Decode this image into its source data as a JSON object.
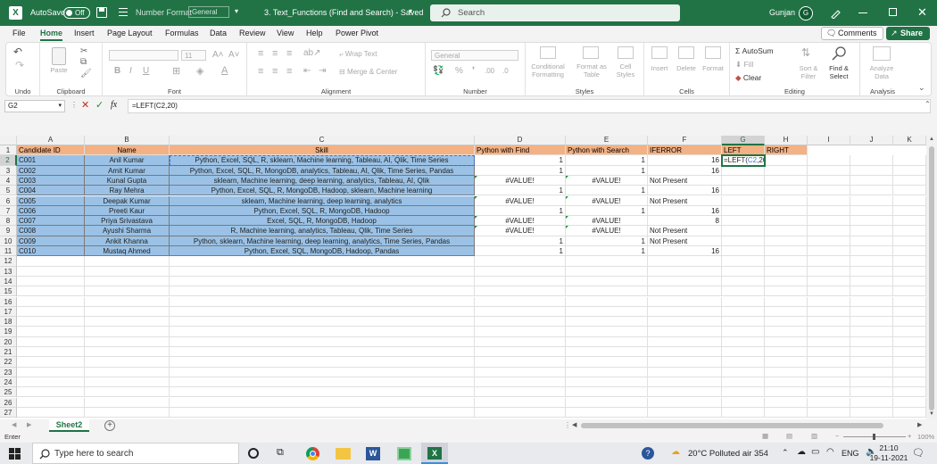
{
  "titlebar": {
    "autosave": "AutoSave",
    "toggle": "Off",
    "number_format": "Number Format",
    "number_format_value": "General",
    "doc_title": "3. Text_Functions (Find and Search)  -  Saved",
    "search_placeholder": "Search",
    "user": "Gunjan",
    "avatar_initial": "G"
  },
  "menu": {
    "tabs": [
      "File",
      "Home",
      "Insert",
      "Page Layout",
      "Formulas",
      "Data",
      "Review",
      "View",
      "Help",
      "Power Pivot"
    ],
    "comments": "Comments",
    "share": "Share"
  },
  "ribbon": {
    "undo": "Undo",
    "clipboard": "Clipboard",
    "paste": "Paste",
    "font": "Font",
    "font_size": "11",
    "alignment": "Alignment",
    "wrap_text": "Wrap Text",
    "merge_center": "Merge & Center",
    "number": "Number",
    "number_format": "General",
    "styles": "Styles",
    "conditional": "Conditional",
    "formatting": "Formatting",
    "format_as": "Format as",
    "table": "Table",
    "cell": "Cell",
    "styles2": "Styles",
    "cells": "Cells",
    "insert": "Insert",
    "delete": "Delete",
    "format": "Format",
    "editing": "Editing",
    "autosum": "AutoSum",
    "fill": "Fill",
    "clear": "Clear",
    "sort": "Sort &",
    "filter": "Filter",
    "find": "Find &",
    "select": "Select",
    "analyze": "Analyze",
    "data": "Data",
    "analysis": "Analysis"
  },
  "formula_bar": {
    "name_box": "G2",
    "fx": "fx",
    "formula": "=LEFT(C2,20)"
  },
  "grid": {
    "columns": [
      "A",
      "B",
      "C",
      "D",
      "E",
      "F",
      "G",
      "H",
      "I",
      "J",
      "K"
    ],
    "rows": [
      "1",
      "2",
      "3",
      "4",
      "5",
      "6",
      "7",
      "8",
      "9",
      "10",
      "11",
      "12",
      "13",
      "14",
      "15",
      "16",
      "17",
      "18",
      "19",
      "20",
      "21",
      "22",
      "23",
      "24",
      "25",
      "26",
      "27"
    ],
    "headers": [
      "Candidate ID",
      "Name",
      "Skill",
      "Python with Find",
      "Python with Search",
      "IFERROR",
      "LEFT",
      "RIGHT"
    ],
    "data": [
      [
        "C001",
        "Anil Kumar",
        "Python, Excel, SQL, R, sklearn, Machine learning, Tableau, AI, Qlik, Time Series",
        "1",
        "1",
        "16"
      ],
      [
        "C002",
        "Amit Kumar",
        "Python, Excel, SQL, R, MongoDB, analytics, Tableau, AI, Qlik, Time Series, Pandas",
        "1",
        "1",
        "16"
      ],
      [
        "C003",
        "Kunal Gupta",
        "sklearn, Machine learning, deep learning, analytics, Tableau, AI, Qlik",
        "#VALUE!",
        "#VALUE!",
        "Not Present"
      ],
      [
        "C004",
        "Ray Mehra",
        "Python, Excel, SQL, R, MongoDB, Hadoop, sklearn, Machine learning",
        "1",
        "1",
        "16"
      ],
      [
        "C005",
        "Deepak Kumar",
        "sklearn, Machine learning, deep learning, analytics",
        "#VALUE!",
        "#VALUE!",
        "Not Present"
      ],
      [
        "C006",
        "Preeti Kaur",
        "Python, Excel, SQL, R, MongoDB, Hadoop",
        "1",
        "1",
        "16"
      ],
      [
        "C007",
        "Priya Srivastava",
        "Excel, SQL, R, MongoDB, Hadoop",
        "#VALUE!",
        "#VALUE!",
        "8"
      ],
      [
        "C008",
        "Ayushi Sharma",
        "R, Machine learning, analytics, Tableau, Qlik, Time Series",
        "#VALUE!",
        "#VALUE!",
        "Not Present"
      ],
      [
        "C009",
        "Ankit Khanna",
        "Python, sklearn, Machine learning, deep learning, analytics, Time Series, Pandas",
        "1",
        "1",
        "Not Present"
      ],
      [
        "C010",
        "Mustaq Ahmed",
        "Python, Excel, SQL, MongoDB, Hadoop, Pandas",
        "1",
        "1",
        "16"
      ]
    ],
    "edit_prefix": "=LEFT(",
    "edit_ref": "C2",
    "edit_suffix": ",20)"
  },
  "sheets": {
    "active": "Sheet2"
  },
  "status": {
    "mode": "Enter",
    "zoom": "100%"
  },
  "taskbar": {
    "search": "Type here to search",
    "weather": "20°C  Polluted air 354",
    "lang": "ENG",
    "time": "21:10",
    "date": "19-11-2021"
  }
}
